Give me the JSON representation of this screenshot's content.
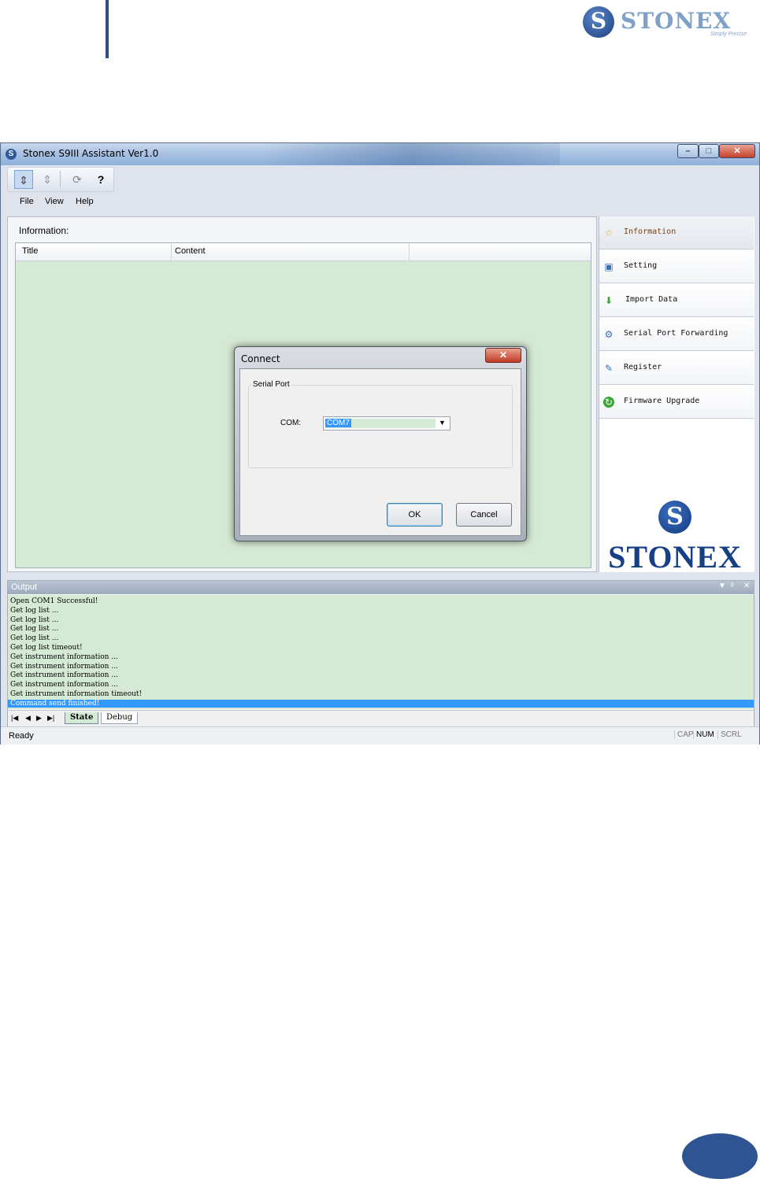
{
  "page": {
    "brand": {
      "name": "STONEX",
      "tagline": "Simply Precise"
    }
  },
  "window": {
    "title": "Stonex S9III Assistant Ver1.0",
    "controls": {
      "minimize": "–",
      "maximize": "□",
      "close": "✕"
    }
  },
  "toolbar": {
    "tools": [
      "connect-icon",
      "disconnect-icon",
      "refresh-icon",
      "help-icon"
    ]
  },
  "menu": {
    "items": [
      "File",
      "View",
      "Help"
    ]
  },
  "information": {
    "label": "Information:",
    "columns": [
      "Title",
      "Content"
    ]
  },
  "nav": {
    "items": [
      {
        "label": "Information",
        "icon": "star-icon",
        "active": true
      },
      {
        "label": "Setting",
        "icon": "setting-icon",
        "active": false
      },
      {
        "label": "Import Data",
        "icon": "download-arrow-icon",
        "active": false
      },
      {
        "label": "Serial Port Forwarding",
        "icon": "network-icon",
        "active": false
      },
      {
        "label": "Register",
        "icon": "register-icon",
        "active": false
      },
      {
        "label": "Firmware Upgrade",
        "icon": "upgrade-icon",
        "active": false
      }
    ],
    "logo_text": "STONEX"
  },
  "output": {
    "title": "Output",
    "lines": [
      "Open COM1 Successful!",
      "Get log list ...",
      "Get log list ...",
      "Get log list ...",
      "Get log list ...",
      "Get log list timeout!",
      "Get instrument information ...",
      "Get instrument information ...",
      "Get instrument information ...",
      "Get instrument information ...",
      "Get instrument information timeout!",
      "Command send finished!"
    ],
    "selected_line": "Command send finished!",
    "tabs": [
      "State",
      "Debug"
    ]
  },
  "status": {
    "text": "Ready",
    "indicators": [
      "CAP",
      "NUM",
      "SCRL"
    ]
  },
  "dialog": {
    "title": "Connect",
    "group_label": "Serial Port",
    "com_label": "COM:",
    "com_value": "COM7",
    "ok_label": "OK",
    "cancel_label": "Cancel"
  },
  "colors": {
    "accent": "#2e5591",
    "list_background": "#d5ead4",
    "selection": "#3399ff"
  }
}
